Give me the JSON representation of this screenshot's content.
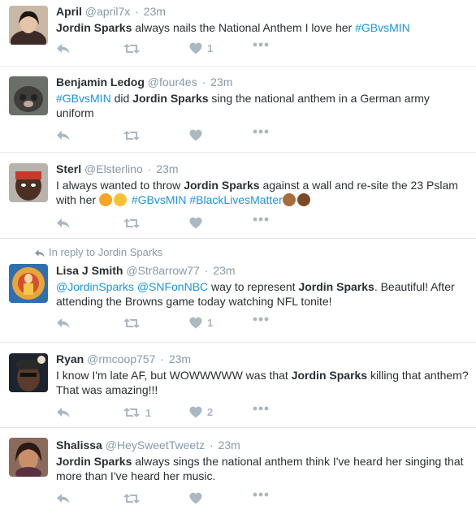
{
  "tweets": [
    {
      "name": "April",
      "handle": "@april7x",
      "time": "23m",
      "segments": [
        {
          "t": "Jordin Sparks",
          "b": true
        },
        {
          "t": " always nails the National Anthem I love her "
        },
        {
          "t": "#GBvsMIN",
          "link": true
        }
      ],
      "likes": "1",
      "retweets": ""
    },
    {
      "name": "Benjamin Ledog",
      "handle": "@four4es",
      "time": "23m",
      "segments": [
        {
          "t": "#GBvsMIN",
          "link": true
        },
        {
          "t": " did "
        },
        {
          "t": "Jordin Sparks",
          "b": true
        },
        {
          "t": " sing the national anthem in a German army uniform"
        }
      ],
      "likes": "",
      "retweets": ""
    },
    {
      "name": "Sterl",
      "handle": "@Elsterlino",
      "time": "23m",
      "segments": [
        {
          "t": "I always wanted to throw "
        },
        {
          "t": "Jordin Sparks",
          "b": true
        },
        {
          "t": " against a wall and re-site the 23 Pslam with her "
        },
        {
          "emoji": "#f5a623"
        },
        {
          "emoji": "#f8c033"
        },
        {
          "t": " "
        },
        {
          "t": "#GBvsMIN",
          "link": true
        },
        {
          "t": "  "
        },
        {
          "t": "#BlackLivesMatter",
          "link": true
        },
        {
          "emoji": "#a86b3a"
        },
        {
          "emoji": "#7a4a26"
        }
      ],
      "likes": "",
      "retweets": ""
    },
    {
      "reply_context": "In reply to Jordin Sparks",
      "name": "Lisa J Smith",
      "handle": "@Str8arrow77",
      "time": "23m",
      "segments": [
        {
          "t": "@JordinSparks",
          "link": true
        },
        {
          "t": " "
        },
        {
          "t": "@SNFonNBC",
          "link": true
        },
        {
          "t": " way to represent "
        },
        {
          "t": "Jordin Sparks",
          "b": true
        },
        {
          "t": ". Beautiful! After attending the Browns game today watching NFL tonite!"
        }
      ],
      "likes": "1",
      "retweets": ""
    },
    {
      "name": "Ryan",
      "handle": "@rmcoop757",
      "time": "23m",
      "segments": [
        {
          "t": "I know I'm late AF, but WOWWWWW was that "
        },
        {
          "t": "Jordin Sparks",
          "b": true
        },
        {
          "t": " killing that anthem? That was amazing!!!"
        }
      ],
      "likes": "2",
      "retweets": "1"
    },
    {
      "name": "Shalissa",
      "handle": "@HeySweetTweetz",
      "time": "23m",
      "segments": [
        {
          "t": "Jordin Sparks",
          "b": true
        },
        {
          "t": " always sings the national anthem think I've heard her singing that more than I've heard her music."
        }
      ],
      "likes": "",
      "retweets": ""
    }
  ],
  "colors": {
    "link": "#1b95e0",
    "muted": "#8899a6",
    "icon": "#aab8c2",
    "divider": "#e1e8ed"
  }
}
